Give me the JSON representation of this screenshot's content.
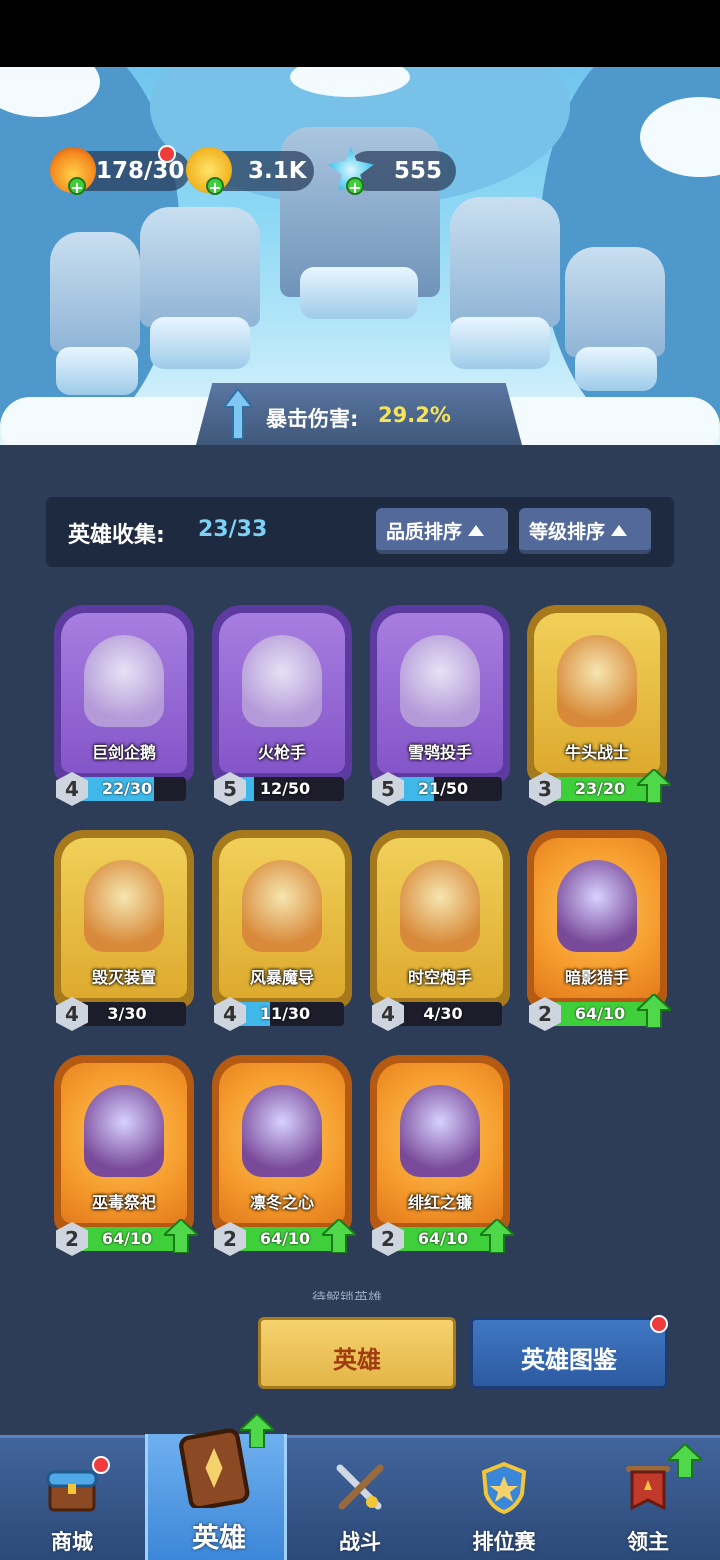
{
  "resources": {
    "stamina": "178/30",
    "coins": "3.1K",
    "gems": "555"
  },
  "crit": {
    "label": "暴击伤害:",
    "value": "29.2%"
  },
  "collection": {
    "title": "英雄收集:",
    "count": "23/33",
    "sort_quality": "品质排序",
    "sort_level": "等级排序"
  },
  "heroes": [
    {
      "name": "巨剑企鹅",
      "rank": "4",
      "progress": "22/30",
      "rarity": "purple",
      "fill": 0.73,
      "upgrade": false
    },
    {
      "name": "火枪手",
      "rank": "5",
      "progress": "12/50",
      "rarity": "purple",
      "fill": 0.24,
      "upgrade": false
    },
    {
      "name": "雪鸮投手",
      "rank": "5",
      "progress": "21/50",
      "rarity": "purple",
      "fill": 0.42,
      "upgrade": false
    },
    {
      "name": "牛头战士",
      "rank": "3",
      "progress": "23/20",
      "rarity": "gold",
      "fill": 1.0,
      "upgrade": true
    },
    {
      "name": "毁灭装置",
      "rank": "4",
      "progress": "3/30",
      "rarity": "gold",
      "fill": 0.1,
      "upgrade": false
    },
    {
      "name": "风暴魔导",
      "rank": "4",
      "progress": "11/30",
      "rarity": "gold",
      "fill": 0.37,
      "upgrade": false
    },
    {
      "name": "时空炮手",
      "rank": "4",
      "progress": "4/30",
      "rarity": "gold",
      "fill": 0.13,
      "upgrade": false
    },
    {
      "name": "暗影猎手",
      "rank": "2",
      "progress": "64/10",
      "rarity": "orange",
      "fill": 1.0,
      "upgrade": true
    },
    {
      "name": "巫毒祭祀",
      "rank": "2",
      "progress": "64/10",
      "rarity": "orange",
      "fill": 1.0,
      "upgrade": true
    },
    {
      "name": "凛冬之心",
      "rank": "2",
      "progress": "64/10",
      "rarity": "orange",
      "fill": 1.0,
      "upgrade": true
    },
    {
      "name": "绯红之镰",
      "rank": "2",
      "progress": "64/10",
      "rarity": "orange",
      "fill": 1.0,
      "upgrade": true
    }
  ],
  "buttons": {
    "hero": "英雄",
    "codex": "英雄图鉴"
  },
  "partial_text": "待解锁英雄",
  "nav": [
    {
      "label": "商城",
      "icon": "chest-icon"
    },
    {
      "label": "英雄",
      "icon": "hero-card-icon"
    },
    {
      "label": "战斗",
      "icon": "crossed-swords-icon"
    },
    {
      "label": "排位赛",
      "icon": "rank-shield-icon"
    },
    {
      "label": "领主",
      "icon": "banner-icon"
    }
  ],
  "colors": {
    "purple_card": "#8455c9",
    "gold_card": "#ddaa2e",
    "orange_card": "#f59a2c",
    "progress_blue": "#3fb7e8",
    "progress_green": "#3fcf3a",
    "panel_bg": "#2d3d58"
  }
}
